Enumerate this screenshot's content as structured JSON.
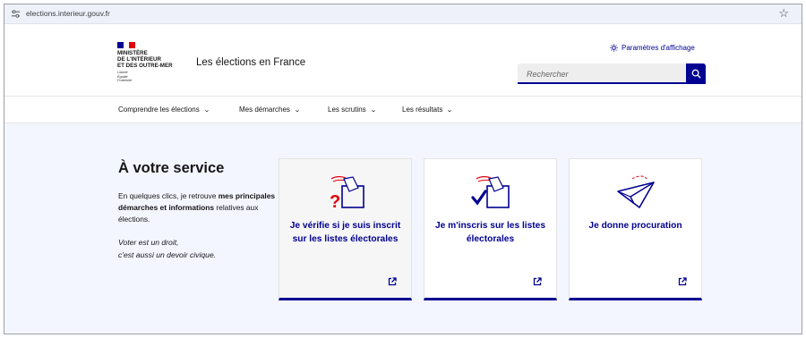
{
  "browser": {
    "url": "elections.interieur.gouv.fr"
  },
  "header": {
    "ministry_lines": [
      "MINISTÈRE",
      "DE L'INTÉRIEUR",
      "ET DES OUTRE-MER"
    ],
    "motto_lines": [
      "Liberté",
      "Égalité",
      "Fraternité"
    ],
    "site_title": "Les élections en France",
    "settings_label": "Paramètres d'affichage",
    "search_placeholder": "Rechercher"
  },
  "nav": {
    "items": [
      {
        "label": "Comprendre les élections"
      },
      {
        "label": "Mes démarches"
      },
      {
        "label": "Les scrutins"
      },
      {
        "label": "Les résultats"
      }
    ]
  },
  "main": {
    "title": "À votre service",
    "intro_before": "En quelques clics, je retrouve ",
    "intro_bold": "mes principales démarches et informations",
    "intro_after": " relatives aux élections.",
    "quote_line1": "Voter est un droit,",
    "quote_line2": "c'est aussi un devoir civique.",
    "cards": [
      {
        "label": "Je vérifie si je suis inscrit sur les listes électorales",
        "icon": "ballot-question-icon"
      },
      {
        "label": "Je m'inscris sur les listes électorales",
        "icon": "ballot-check-icon"
      },
      {
        "label": "Je donne procuration",
        "icon": "paper-plane-icon"
      }
    ]
  },
  "colors": {
    "primary": "#000091",
    "accent_red": "#e1000f",
    "background_tint": "#f4f6ff"
  }
}
